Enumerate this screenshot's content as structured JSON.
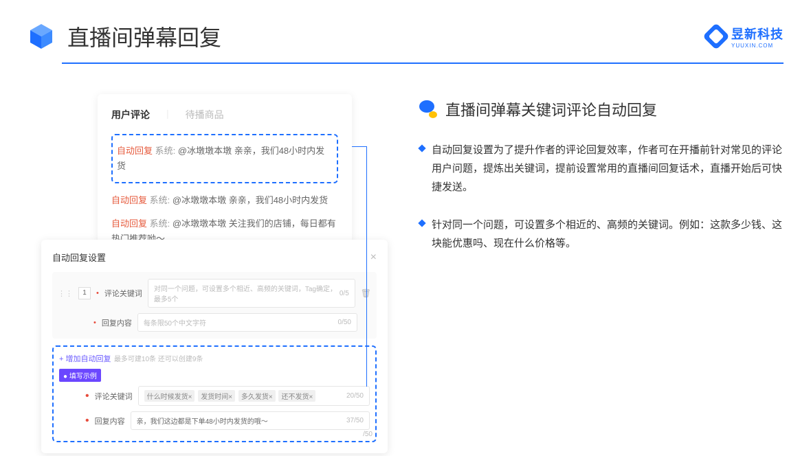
{
  "header": {
    "title": "直播间弹幕回复"
  },
  "brand": {
    "name": "昱新科技",
    "sub": "YUUXIN.COM"
  },
  "comments": {
    "tab_active": "用户评论",
    "tab_inactive": "待播商品",
    "row1_tag": "自动回复",
    "row1_sys": "系统:",
    "row1_text": "@冰墩墩本墩 亲亲，我们48小时内发货",
    "row2_tag": "自动回复",
    "row2_sys": "系统:",
    "row2_text": "@冰墩墩本墩 亲亲，我们48小时内发货",
    "row3_tag": "自动回复",
    "row3_sys": "系统:",
    "row3_text": "@冰墩墩本墩 关注我们的店铺，每日都有热门推荐呦～"
  },
  "settings": {
    "title": "自动回复设置",
    "num": "1",
    "kw_label": "评论关键词",
    "kw_placeholder": "对同一个问题，可设置多个相近、高频的关键词，Tag确定，最多5个",
    "kw_counter": "0/5",
    "content_label": "回复内容",
    "content_placeholder": "每条限50个中文字符",
    "content_counter": "0/50",
    "add_link": "+ 增加自动回复",
    "add_note": "最多可建10条 还可以创建9条",
    "example_badge": "● 填写示例",
    "ex_kw_label": "评论关键词",
    "ex_tags": [
      "什么时候发货×",
      "发货时间×",
      "多久发货×",
      "还不发货×"
    ],
    "ex_kw_counter": "20/50",
    "ex_content_label": "回复内容",
    "ex_content_text": "亲，我们这边都是下单48小时内发货的哦～",
    "ex_content_counter": "37/50",
    "outer_counter": "/50"
  },
  "right": {
    "title": "直播间弹幕关键词评论自动回复",
    "b1": "自动回复设置为了提升作者的评论回复效率，作者可在开播前针对常见的评论用户问题，提炼出关键词，提前设置常用的直播间回复话术，直播开始后可快捷发送。",
    "b2": "针对同一个问题，可设置多个相近的、高频的关键词。例如：这款多少钱、这块能优惠吗、现在什么价格等。"
  }
}
